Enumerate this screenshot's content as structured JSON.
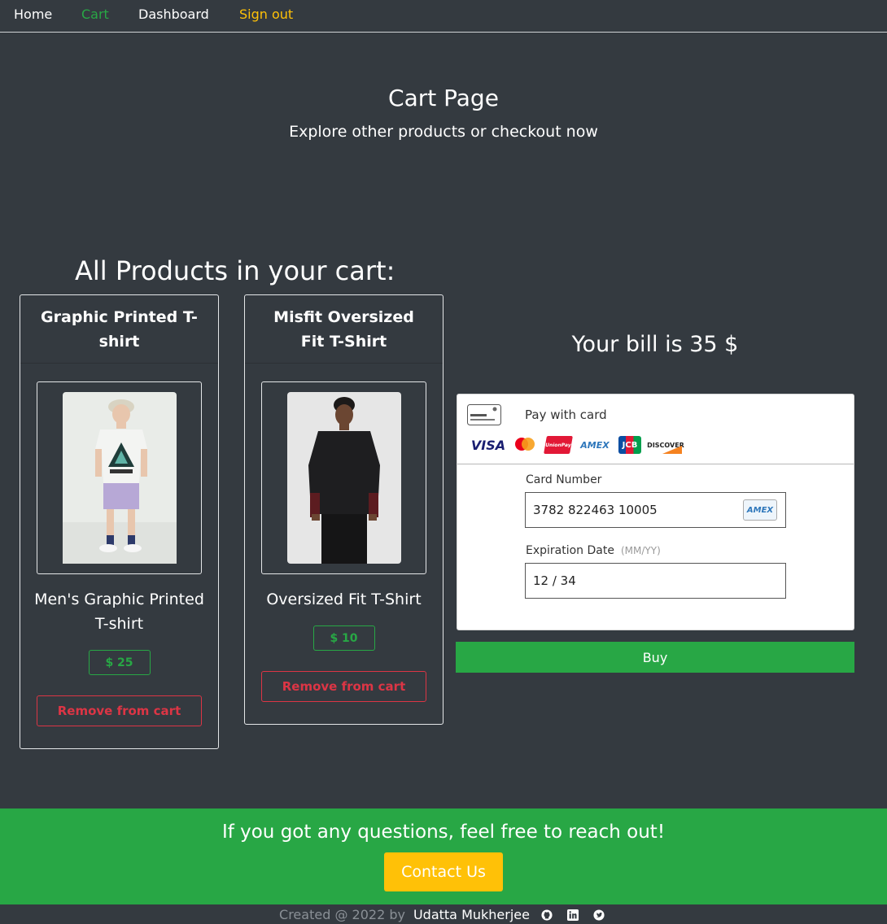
{
  "nav": {
    "home": "Home",
    "cart": "Cart",
    "dashboard": "Dashboard",
    "signout": "Sign out"
  },
  "hero": {
    "title": "Cart Page",
    "subtitle": "Explore other products or checkout now"
  },
  "cart": {
    "heading": "All Products in your cart:",
    "items": [
      {
        "header": "Graphic Printed T-shirt",
        "title": "Men's Graphic Printed T-shirt",
        "price": "$ 25",
        "remove_label": "Remove from cart"
      },
      {
        "header": "Misfit Oversized Fit T-Shirt",
        "title": "Oversized Fit T-Shirt",
        "price": "$ 10",
        "remove_label": "Remove from cart"
      }
    ]
  },
  "bill": {
    "text": "Your bill is 35 $"
  },
  "payment": {
    "label": "Pay with card",
    "brands": [
      "VISA",
      "mastercard",
      "UnionPay",
      "AMEX",
      "JCB",
      "DISCOVER"
    ],
    "card_number_label": "Card Number",
    "card_number_value": "3782 822463 10005",
    "detected_brand": "AMEX",
    "expiry_label": "Expiration Date",
    "expiry_hint": "(MM/YY)",
    "expiry_value": "12 / 34",
    "buy_label": "Buy"
  },
  "footer": {
    "text": "If you got any questions, feel free to reach out!",
    "contact_label": "Contact Us",
    "credit_prefix": "Created @ 2022 by",
    "credit_name": "Udatta Mukherjee"
  },
  "colors": {
    "background": "#343a40",
    "success": "#28a745",
    "danger": "#dc3545",
    "warning": "#ffc107"
  }
}
